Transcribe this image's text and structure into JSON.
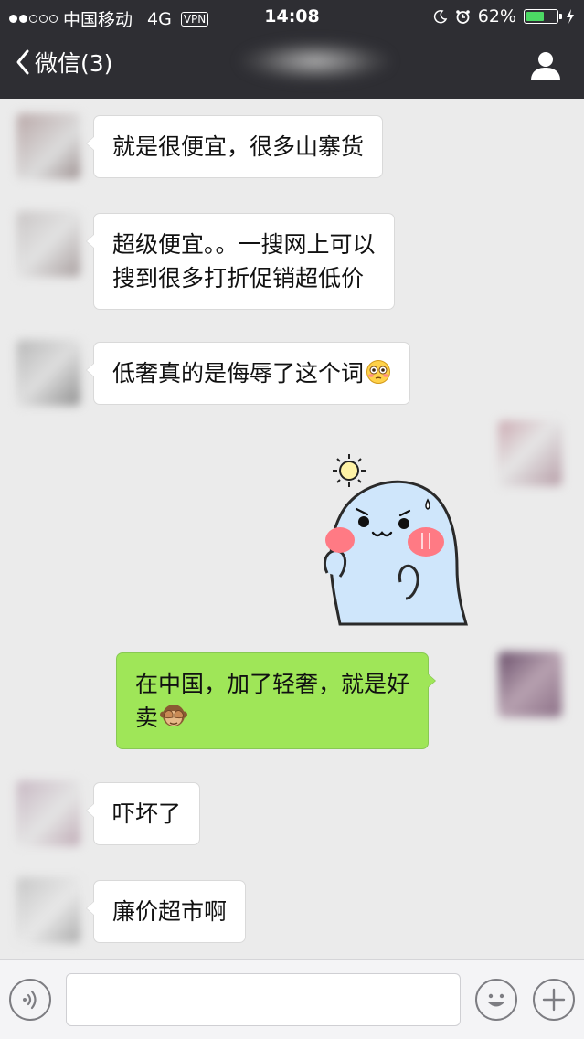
{
  "status_bar": {
    "carrier": "中国移动",
    "network": "4G",
    "vpn": "VPN",
    "time": "14:08",
    "battery": "62%",
    "battery_level": 0.62,
    "battery_color": "#4cd964"
  },
  "nav": {
    "back_label": "微信(3)",
    "icons": {
      "back": "chevron-left-icon",
      "profile": "person-icon"
    }
  },
  "messages": [
    {
      "side": "in",
      "lines": [
        "就是很便宜，很多山寨货"
      ]
    },
    {
      "side": "in",
      "lines": [
        "超级便宜。。一搜网上可以",
        "搜到很多打折促销超低价"
      ]
    },
    {
      "side": "in",
      "lines": [
        "低奢真的是侮辱了这个词"
      ],
      "emoji": "flushed-face-emoji"
    },
    {
      "side": "out",
      "type": "sticker",
      "sticker": "shy-blue-ghost-sticker"
    },
    {
      "side": "out",
      "lines": [
        "在中国，加了轻奢，就是好",
        "卖"
      ],
      "emoji": "see-no-evil-monkey-emoji"
    },
    {
      "side": "in",
      "lines": [
        "吓坏了"
      ]
    },
    {
      "side": "in",
      "lines": [
        "廉价超市啊"
      ]
    }
  ],
  "input_bar": {
    "text_value": "",
    "icons": {
      "voice": "voice-icon",
      "emoji": "smiley-face-icon",
      "more": "plus-icon"
    }
  },
  "colors": {
    "header_bg": "#2e2e33",
    "chat_bg": "#ebebeb",
    "bubble_in": "#ffffff",
    "bubble_out": "#9fe658"
  }
}
